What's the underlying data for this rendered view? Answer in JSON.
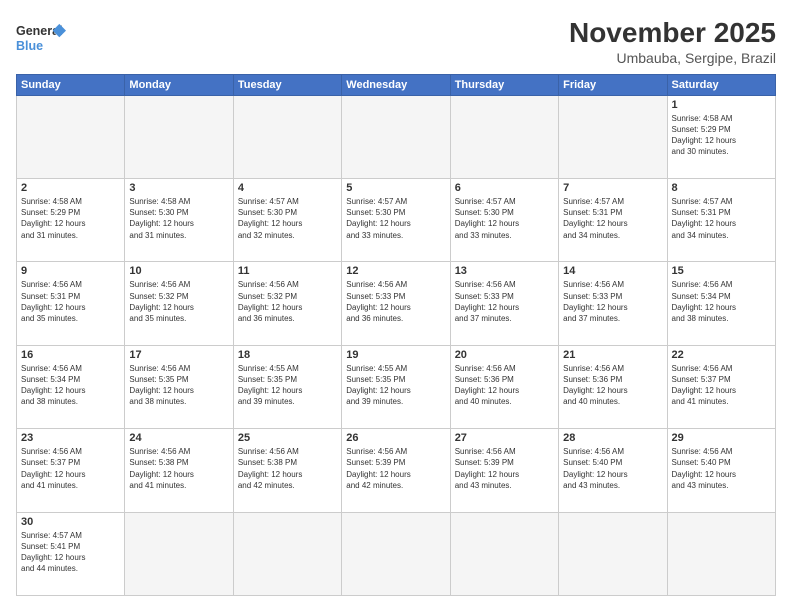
{
  "logo": {
    "text_general": "General",
    "text_blue": "Blue"
  },
  "header": {
    "title": "November 2025",
    "subtitle": "Umbauba, Sergipe, Brazil"
  },
  "weekdays": [
    "Sunday",
    "Monday",
    "Tuesday",
    "Wednesday",
    "Thursday",
    "Friday",
    "Saturday"
  ],
  "weeks": [
    [
      {
        "day": "",
        "info": ""
      },
      {
        "day": "",
        "info": ""
      },
      {
        "day": "",
        "info": ""
      },
      {
        "day": "",
        "info": ""
      },
      {
        "day": "",
        "info": ""
      },
      {
        "day": "",
        "info": ""
      },
      {
        "day": "1",
        "info": "Sunrise: 4:58 AM\nSunset: 5:29 PM\nDaylight: 12 hours\nand 30 minutes."
      }
    ],
    [
      {
        "day": "2",
        "info": "Sunrise: 4:58 AM\nSunset: 5:29 PM\nDaylight: 12 hours\nand 31 minutes."
      },
      {
        "day": "3",
        "info": "Sunrise: 4:58 AM\nSunset: 5:30 PM\nDaylight: 12 hours\nand 31 minutes."
      },
      {
        "day": "4",
        "info": "Sunrise: 4:57 AM\nSunset: 5:30 PM\nDaylight: 12 hours\nand 32 minutes."
      },
      {
        "day": "5",
        "info": "Sunrise: 4:57 AM\nSunset: 5:30 PM\nDaylight: 12 hours\nand 33 minutes."
      },
      {
        "day": "6",
        "info": "Sunrise: 4:57 AM\nSunset: 5:30 PM\nDaylight: 12 hours\nand 33 minutes."
      },
      {
        "day": "7",
        "info": "Sunrise: 4:57 AM\nSunset: 5:31 PM\nDaylight: 12 hours\nand 34 minutes."
      },
      {
        "day": "8",
        "info": "Sunrise: 4:57 AM\nSunset: 5:31 PM\nDaylight: 12 hours\nand 34 minutes."
      }
    ],
    [
      {
        "day": "9",
        "info": "Sunrise: 4:56 AM\nSunset: 5:31 PM\nDaylight: 12 hours\nand 35 minutes."
      },
      {
        "day": "10",
        "info": "Sunrise: 4:56 AM\nSunset: 5:32 PM\nDaylight: 12 hours\nand 35 minutes."
      },
      {
        "day": "11",
        "info": "Sunrise: 4:56 AM\nSunset: 5:32 PM\nDaylight: 12 hours\nand 36 minutes."
      },
      {
        "day": "12",
        "info": "Sunrise: 4:56 AM\nSunset: 5:33 PM\nDaylight: 12 hours\nand 36 minutes."
      },
      {
        "day": "13",
        "info": "Sunrise: 4:56 AM\nSunset: 5:33 PM\nDaylight: 12 hours\nand 37 minutes."
      },
      {
        "day": "14",
        "info": "Sunrise: 4:56 AM\nSunset: 5:33 PM\nDaylight: 12 hours\nand 37 minutes."
      },
      {
        "day": "15",
        "info": "Sunrise: 4:56 AM\nSunset: 5:34 PM\nDaylight: 12 hours\nand 38 minutes."
      }
    ],
    [
      {
        "day": "16",
        "info": "Sunrise: 4:56 AM\nSunset: 5:34 PM\nDaylight: 12 hours\nand 38 minutes."
      },
      {
        "day": "17",
        "info": "Sunrise: 4:56 AM\nSunset: 5:35 PM\nDaylight: 12 hours\nand 38 minutes."
      },
      {
        "day": "18",
        "info": "Sunrise: 4:55 AM\nSunset: 5:35 PM\nDaylight: 12 hours\nand 39 minutes."
      },
      {
        "day": "19",
        "info": "Sunrise: 4:55 AM\nSunset: 5:35 PM\nDaylight: 12 hours\nand 39 minutes."
      },
      {
        "day": "20",
        "info": "Sunrise: 4:56 AM\nSunset: 5:36 PM\nDaylight: 12 hours\nand 40 minutes."
      },
      {
        "day": "21",
        "info": "Sunrise: 4:56 AM\nSunset: 5:36 PM\nDaylight: 12 hours\nand 40 minutes."
      },
      {
        "day": "22",
        "info": "Sunrise: 4:56 AM\nSunset: 5:37 PM\nDaylight: 12 hours\nand 41 minutes."
      }
    ],
    [
      {
        "day": "23",
        "info": "Sunrise: 4:56 AM\nSunset: 5:37 PM\nDaylight: 12 hours\nand 41 minutes."
      },
      {
        "day": "24",
        "info": "Sunrise: 4:56 AM\nSunset: 5:38 PM\nDaylight: 12 hours\nand 41 minutes."
      },
      {
        "day": "25",
        "info": "Sunrise: 4:56 AM\nSunset: 5:38 PM\nDaylight: 12 hours\nand 42 minutes."
      },
      {
        "day": "26",
        "info": "Sunrise: 4:56 AM\nSunset: 5:39 PM\nDaylight: 12 hours\nand 42 minutes."
      },
      {
        "day": "27",
        "info": "Sunrise: 4:56 AM\nSunset: 5:39 PM\nDaylight: 12 hours\nand 43 minutes."
      },
      {
        "day": "28",
        "info": "Sunrise: 4:56 AM\nSunset: 5:40 PM\nDaylight: 12 hours\nand 43 minutes."
      },
      {
        "day": "29",
        "info": "Sunrise: 4:56 AM\nSunset: 5:40 PM\nDaylight: 12 hours\nand 43 minutes."
      }
    ],
    [
      {
        "day": "30",
        "info": "Sunrise: 4:57 AM\nSunset: 5:41 PM\nDaylight: 12 hours\nand 44 minutes."
      },
      {
        "day": "",
        "info": ""
      },
      {
        "day": "",
        "info": ""
      },
      {
        "day": "",
        "info": ""
      },
      {
        "day": "",
        "info": ""
      },
      {
        "day": "",
        "info": ""
      },
      {
        "day": "",
        "info": ""
      }
    ]
  ]
}
